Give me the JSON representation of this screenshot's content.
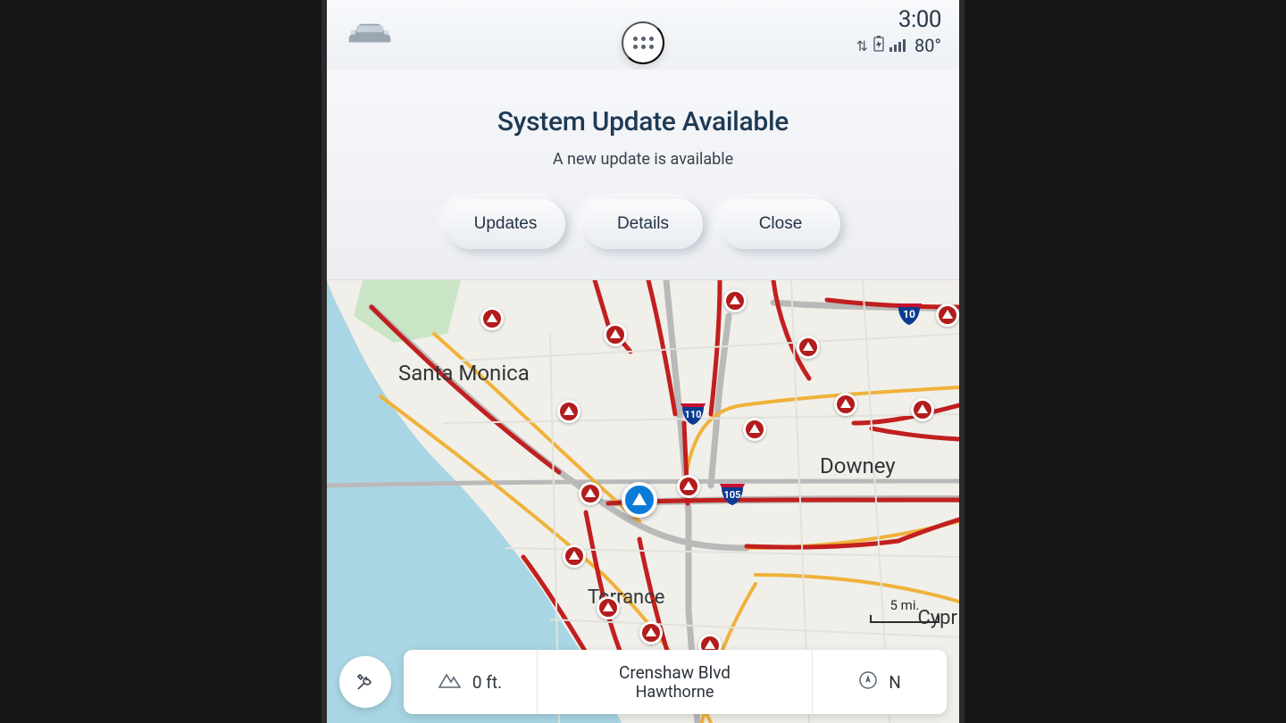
{
  "topbar": {
    "clock": "3:00",
    "temperature": "80°"
  },
  "notification": {
    "title": "System Update Available",
    "subtitle": "A new update is available",
    "buttons": {
      "updates": "Updates",
      "details": "Details",
      "close": "Close"
    }
  },
  "map": {
    "city_labels": {
      "santa_monica": "Santa Monica",
      "downey": "Downey",
      "torrance": "Torrance",
      "cypress": "Cypr"
    },
    "highways": {
      "i10": "10",
      "i110": "110",
      "i105": "105"
    },
    "scale_label": "5 mi.",
    "alert_count": 15
  },
  "bottom": {
    "elevation": "0 ft.",
    "street": "Crenshaw Blvd",
    "city": "Hawthorne",
    "heading": "N"
  }
}
